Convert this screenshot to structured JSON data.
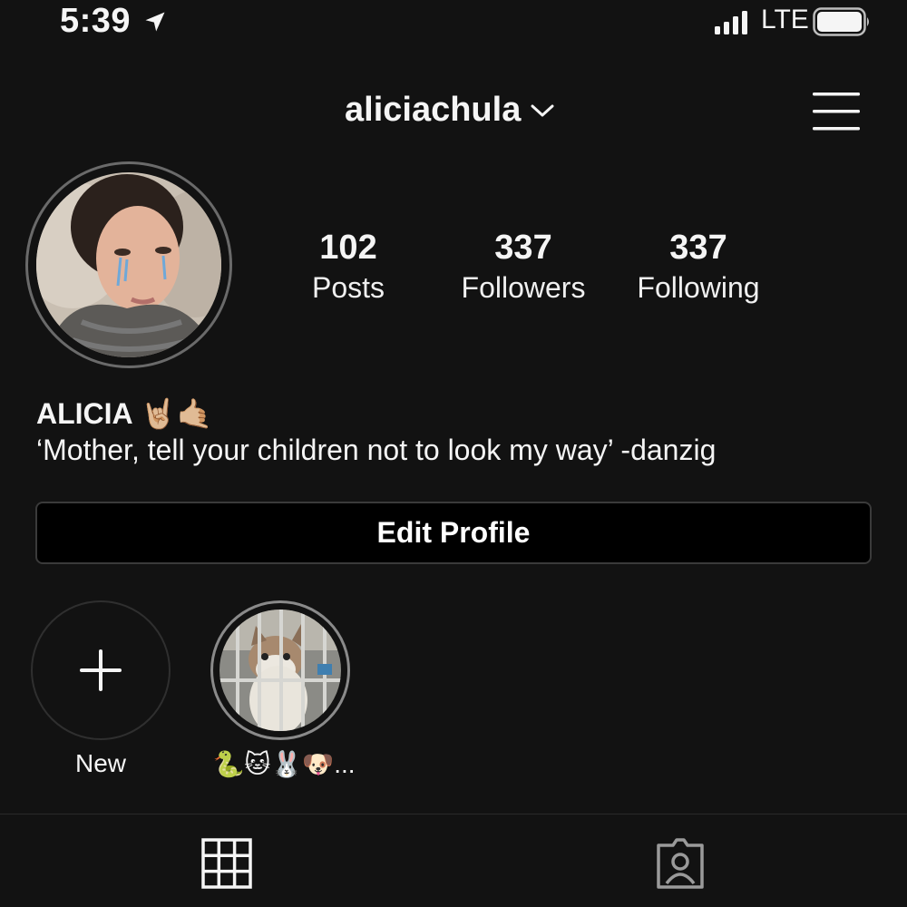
{
  "status_bar": {
    "time": "5:39",
    "network": "LTE",
    "icons": [
      "location-arrow-icon",
      "signal-icon",
      "battery-icon"
    ]
  },
  "header": {
    "username": "aliciachula",
    "icons": [
      "chevron-down-icon",
      "hamburger-menu-icon"
    ]
  },
  "profile": {
    "stats": [
      {
        "value": "102",
        "label": "Posts"
      },
      {
        "value": "337",
        "label": "Followers"
      },
      {
        "value": "337",
        "label": "Following"
      }
    ],
    "name": "ALICIA",
    "name_emoji": "🤘🏼🤙🏼",
    "bio": "‘Mother, tell your children not to look my way’ -danzig",
    "edit_button": "Edit Profile"
  },
  "highlights": [
    {
      "label": "New",
      "icon": "plus-icon"
    },
    {
      "label": "🐍🐱🐰🐶..."
    }
  ],
  "tabs": [
    "grid-icon",
    "tagged-person-icon"
  ],
  "colors": {
    "background": "#121212",
    "text": "#f5f5f5",
    "button_bg": "#000000",
    "border": "#3a3a3a"
  }
}
